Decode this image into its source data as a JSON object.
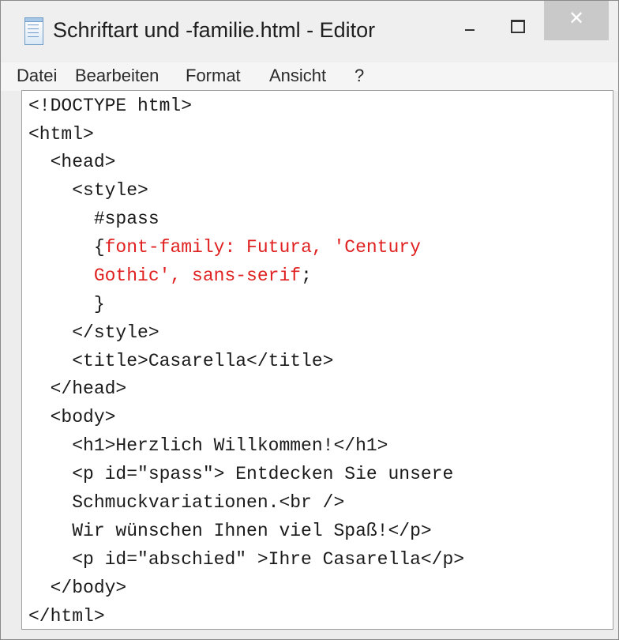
{
  "window": {
    "title": "Schriftart und -familie.html - Editor",
    "close_glyph": "✕"
  },
  "menu": [
    "Datei",
    "Bearbeiten",
    "Format",
    "Ansicht",
    "?"
  ],
  "code": {
    "l1": "<!DOCTYPE html>",
    "l2": "<html>",
    "l3": "  <head>",
    "l4": "    <style>",
    "l5": "      #spass",
    "l6_pre": "      {",
    "l6_red": "font-family: Futura, 'Century",
    "l7_pre": "      ",
    "l7_red": "Gothic', sans-serif",
    "l7_post": ";",
    "l8": "      }",
    "l9": "    </style>",
    "l10": "    <title>Casarella</title>",
    "l11": "  </head>",
    "l12": "  <body>",
    "l13": "    <h1>Herzlich Willkommen!</h1>",
    "l14": "    <p id=\"spass\"> Entdecken Sie unsere",
    "l15": "    Schmuckvariationen.<br />",
    "l16": "    Wir wünschen Ihnen viel Spaß!</p>",
    "l17": "    <p id=\"abschied\" >Ihre Casarella</p>",
    "l18": "  </body>",
    "l19": "</html>"
  },
  "colors": {
    "highlight": "#e02020",
    "text": "#1a1a1a",
    "close_button": "#c9c9c9"
  }
}
